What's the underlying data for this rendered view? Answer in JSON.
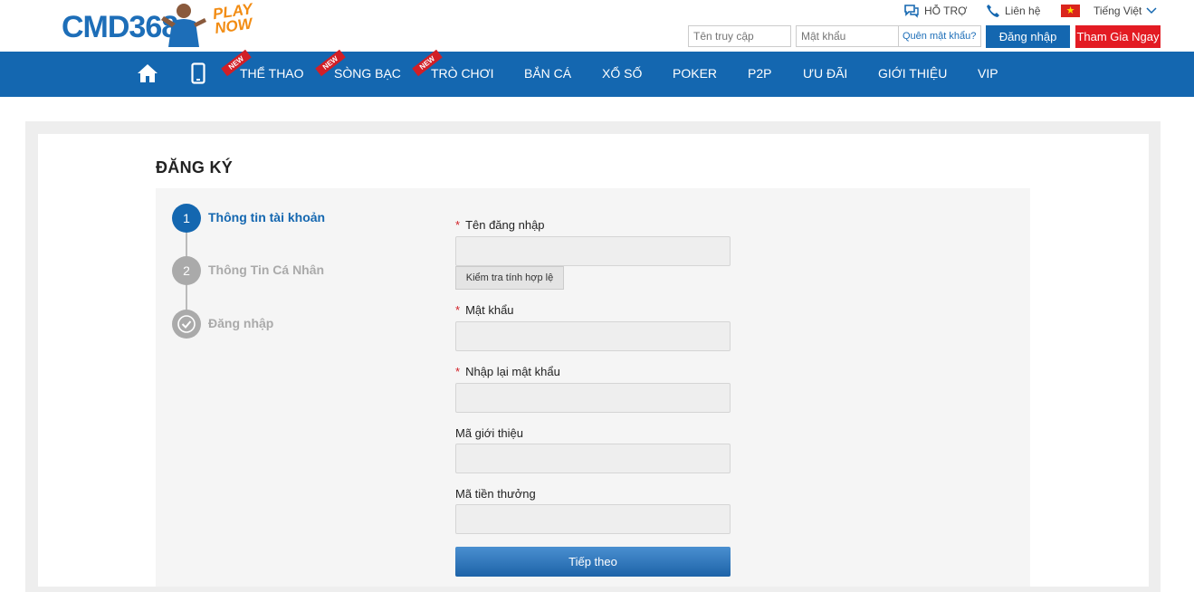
{
  "header": {
    "logo_text": "CMD368",
    "logo_tagline": "PLAY NOW",
    "support_label": "HỖ TRỢ",
    "contact_label": "Liên hệ",
    "language_label": "Tiếng Việt",
    "username_placeholder": "Tên truy cập",
    "password_placeholder": "Mật khẩu",
    "forgot_password": "Quên mật khẩu?",
    "login_button": "Đăng nhập",
    "join_button": "Tham Gia Ngay"
  },
  "nav": {
    "items": [
      {
        "label": "THỂ THAO",
        "new": true
      },
      {
        "label": "SÒNG BẠC",
        "new": true
      },
      {
        "label": "TRÒ CHƠI",
        "new": true
      },
      {
        "label": "BẮN CÁ"
      },
      {
        "label": "XỔ SỐ"
      },
      {
        "label": "POKER"
      },
      {
        "label": "P2P"
      },
      {
        "label": "ƯU ĐÃI"
      },
      {
        "label": "GIỚI THIỆU"
      },
      {
        "label": "VIP"
      }
    ],
    "new_badge": "NEW"
  },
  "page": {
    "title": "ĐĂNG KÝ",
    "steps": [
      {
        "number": "1",
        "label": "Thông tin tài khoản"
      },
      {
        "number": "2",
        "label": "Thông Tin Cá Nhân"
      },
      {
        "number": "",
        "label": "Đăng nhập"
      }
    ],
    "fields": {
      "username_label": "Tên đăng nhập",
      "check_button": "Kiểm tra tính hợp lệ",
      "password_label": "Mật khẩu",
      "confirm_label": "Nhập lại mật khẩu",
      "referral_label": "Mã giới thiệu",
      "bonus_label": "Mã tiền thưởng"
    },
    "required_mark": "*",
    "next_button": "Tiếp theo"
  }
}
